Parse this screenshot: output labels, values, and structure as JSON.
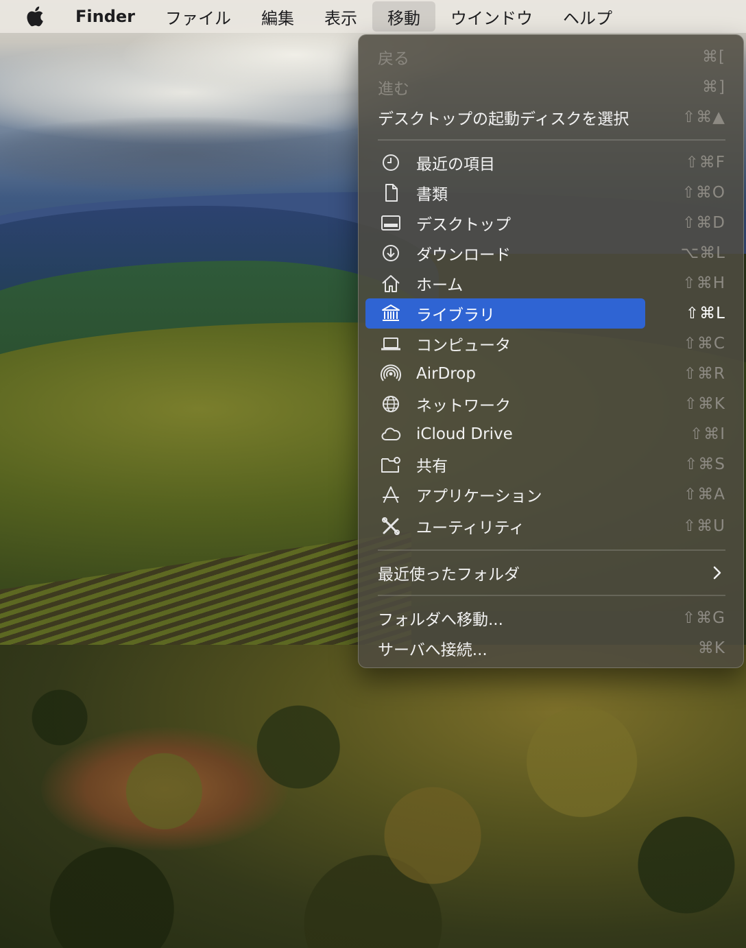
{
  "menubar": {
    "app_name": "Finder",
    "items": [
      "ファイル",
      "編集",
      "表示",
      "移動",
      "ウインドウ",
      "ヘルプ"
    ]
  },
  "go_menu": {
    "back": {
      "label": "戻る",
      "shortcut": "⌘["
    },
    "forward": {
      "label": "進む",
      "shortcut": "⌘]"
    },
    "startup_disk": {
      "label": "デスクトップの起動ディスクを選択",
      "shortcut": "⇧⌘▲"
    },
    "places": [
      {
        "label": "最近の項目",
        "shortcut": "⇧⌘F",
        "icon": "clock-icon"
      },
      {
        "label": "書類",
        "shortcut": "⇧⌘O",
        "icon": "document-icon"
      },
      {
        "label": "デスクトップ",
        "shortcut": "⇧⌘D",
        "icon": "desktop-icon"
      },
      {
        "label": "ダウンロード",
        "shortcut": "⌥⌘L",
        "icon": "download-icon"
      },
      {
        "label": "ホーム",
        "shortcut": "⇧⌘H",
        "icon": "home-icon"
      },
      {
        "label": "ライブラリ",
        "shortcut": "⇧⌘L",
        "icon": "library-icon"
      },
      {
        "label": "コンピュータ",
        "shortcut": "⇧⌘C",
        "icon": "laptop-icon"
      },
      {
        "label": "AirDrop",
        "shortcut": "⇧⌘R",
        "icon": "airdrop-icon"
      },
      {
        "label": "ネットワーク",
        "shortcut": "⇧⌘K",
        "icon": "globe-icon"
      },
      {
        "label": "iCloud Drive",
        "shortcut": "⇧⌘I",
        "icon": "cloud-icon"
      },
      {
        "label": "共有",
        "shortcut": "⇧⌘S",
        "icon": "shared-folder-icon"
      },
      {
        "label": "アプリケーション",
        "shortcut": "⇧⌘A",
        "icon": "applications-icon"
      },
      {
        "label": "ユーティリティ",
        "shortcut": "⇧⌘U",
        "icon": "utilities-icon"
      }
    ],
    "recent_folders": {
      "label": "最近使ったフォルダ"
    },
    "go_to_folder": {
      "label": "フォルダへ移動...",
      "shortcut": "⇧⌘G"
    },
    "connect_server": {
      "label": "サーバへ接続...",
      "shortcut": "⌘K"
    }
  },
  "colors": {
    "highlight": "#2f64d3",
    "menu_bg": "#4e4a40",
    "menubar_bg": "#e9e6e0"
  }
}
